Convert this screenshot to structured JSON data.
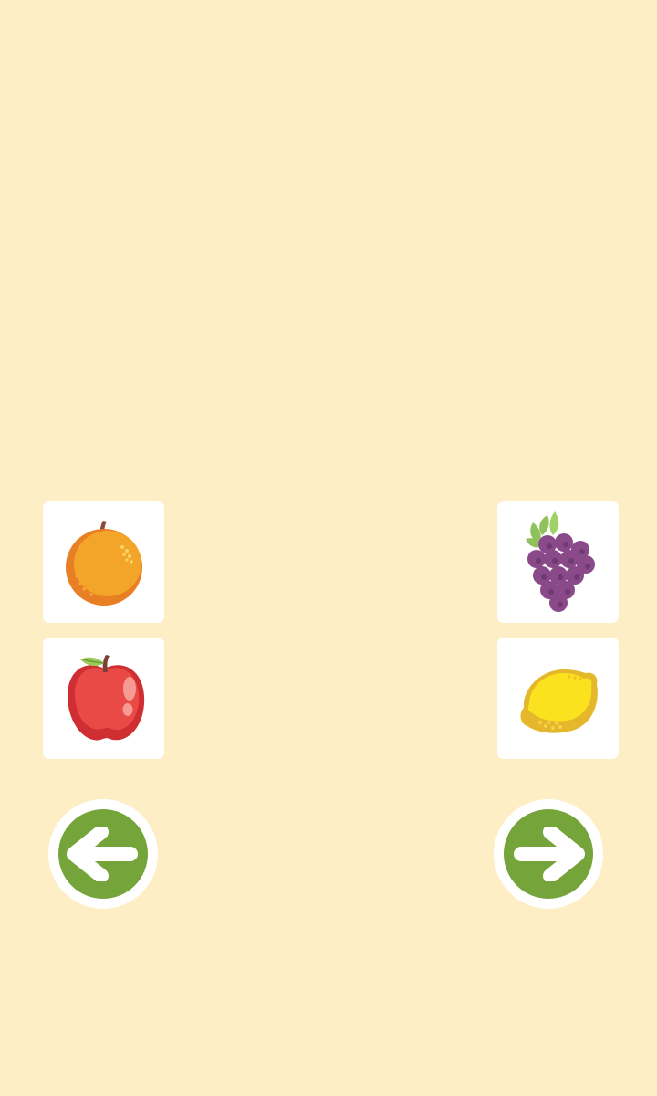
{
  "colors": {
    "background": "#fdeec6",
    "card": "#ffffff",
    "nav_button": "#74a43a",
    "nav_arrow": "#ffffff"
  },
  "fruit_cards": [
    {
      "icon": "orange-icon",
      "position": "left-top"
    },
    {
      "icon": "apple-icon",
      "position": "left-bottom"
    },
    {
      "icon": "grapes-icon",
      "position": "right-top"
    },
    {
      "icon": "lemon-icon",
      "position": "right-bottom"
    }
  ],
  "navigation": {
    "previous_icon": "arrow-left-icon",
    "next_icon": "arrow-right-icon"
  }
}
